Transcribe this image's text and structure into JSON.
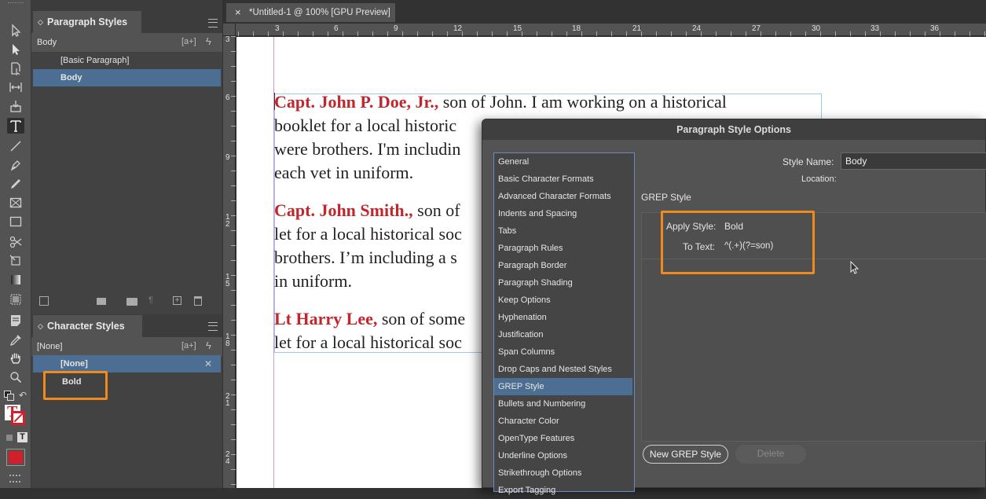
{
  "toolbar": {
    "tools": [
      "selection-tool-icon",
      "direct-selection-tool-icon",
      "page-tool-icon",
      "gap-tool-icon",
      "content-collector-icon",
      "type-tool-icon",
      "line-tool-icon",
      "pen-tool-icon",
      "pencil-tool-icon",
      "rectangle-frame-tool-icon",
      "rectangle-tool-icon",
      "scissors-tool-icon",
      "free-transform-tool-icon",
      "gradient-swatch-tool-icon",
      "gradient-feather-tool-icon",
      "note-tool-icon",
      "eyedropper-tool-icon",
      "hand-tool-icon",
      "zoom-tool-icon"
    ],
    "fill_stroke_letter": "T",
    "formatting_letter": "T",
    "fill_color": "#d0202a"
  },
  "paragraph_styles": {
    "title": "Paragraph Styles",
    "current": "Body",
    "new_style_hint": "[a+]",
    "items": [
      "[Basic Paragraph]",
      "Body"
    ],
    "selected_index": 1
  },
  "character_styles": {
    "title": "Character Styles",
    "current": "[None]",
    "new_style_hint": "[a+]",
    "items": [
      "[None]",
      "Bold"
    ],
    "selected_index": 0
  },
  "document": {
    "tab_close": "×",
    "tab_title": "*Untitled-1 @ 100% [GPU Preview]",
    "h_ruler": [
      "3",
      "6",
      "9",
      "12",
      "15",
      "18",
      "21",
      "24",
      "27",
      "30",
      "33",
      "36"
    ],
    "v_ruler": [
      "3",
      "6",
      "9",
      "1\n2",
      "1\n5",
      "1\n8",
      "2\n1",
      "2\n4"
    ],
    "paragraphs": [
      {
        "name": "Capt. John P. Doe, Jr.,",
        "lines": [
          " son of John. I am working on a historical",
          "booklet for a local historic",
          "were brothers. I'm includin",
          "each vet in uniform."
        ]
      },
      {
        "name": "Capt. John Smith.,",
        "lines": [
          " son of",
          "let for a local historical soc",
          "brothers. I’m including a s",
          "in uniform."
        ]
      },
      {
        "name": "Lt Harry Lee,",
        "lines": [
          " son of some",
          "let for a local historical soc"
        ]
      }
    ]
  },
  "dialog": {
    "title": "Paragraph Style Options",
    "categories": [
      "General",
      "Basic Character Formats",
      "Advanced Character Formats",
      "Indents and Spacing",
      "Tabs",
      "Paragraph Rules",
      "Paragraph Border",
      "Paragraph Shading",
      "Keep Options",
      "Hyphenation",
      "Justification",
      "Span Columns",
      "Drop Caps and Nested Styles",
      "GREP Style",
      "Bullets and Numbering",
      "Character Color",
      "OpenType Features",
      "Underline Options",
      "Strikethrough Options",
      "Export Tagging"
    ],
    "selected_category": 13,
    "style_name_label": "Style Name:",
    "style_name_value": "Body",
    "location_label": "Location:",
    "section_title": "GREP Style",
    "apply_style_label": "Apply Style:",
    "apply_style_value": "Bold",
    "to_text_label": "To Text:",
    "to_text_value": "^(.+)(?=son)",
    "new_grep_button": "New GREP Style",
    "delete_button": "Delete"
  },
  "highlight_color": "#f08a1c"
}
